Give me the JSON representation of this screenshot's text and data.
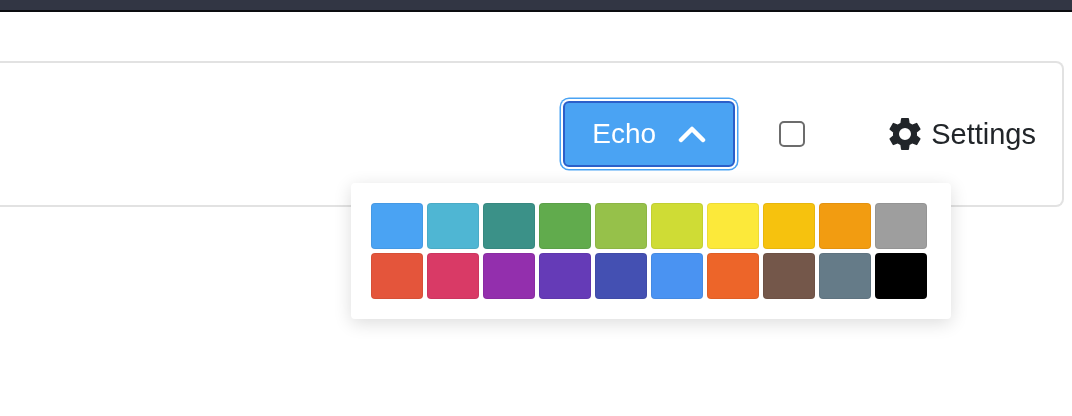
{
  "toolbar": {
    "color_button": {
      "label": "Echo",
      "expanded": true
    },
    "checkbox": {
      "checked": false
    },
    "settings": {
      "label": "Settings"
    }
  },
  "palette": {
    "swatches": [
      {
        "color": "#4aa3f3"
      },
      {
        "color": "#4fb6d3"
      },
      {
        "color": "#3b9188"
      },
      {
        "color": "#61ab4d"
      },
      {
        "color": "#96c14a"
      },
      {
        "color": "#cfdc35"
      },
      {
        "color": "#fce93a"
      },
      {
        "color": "#f6c20e"
      },
      {
        "color": "#f29c11"
      },
      {
        "color": "#9e9e9e"
      },
      {
        "color": "#e4553b"
      },
      {
        "color": "#d93a66"
      },
      {
        "color": "#932fad"
      },
      {
        "color": "#653bb7"
      },
      {
        "color": "#4450b2"
      },
      {
        "color": "#4a93f2"
      },
      {
        "color": "#ed6529"
      },
      {
        "color": "#74574a"
      },
      {
        "color": "#657b88"
      },
      {
        "color": "#000000"
      }
    ]
  }
}
